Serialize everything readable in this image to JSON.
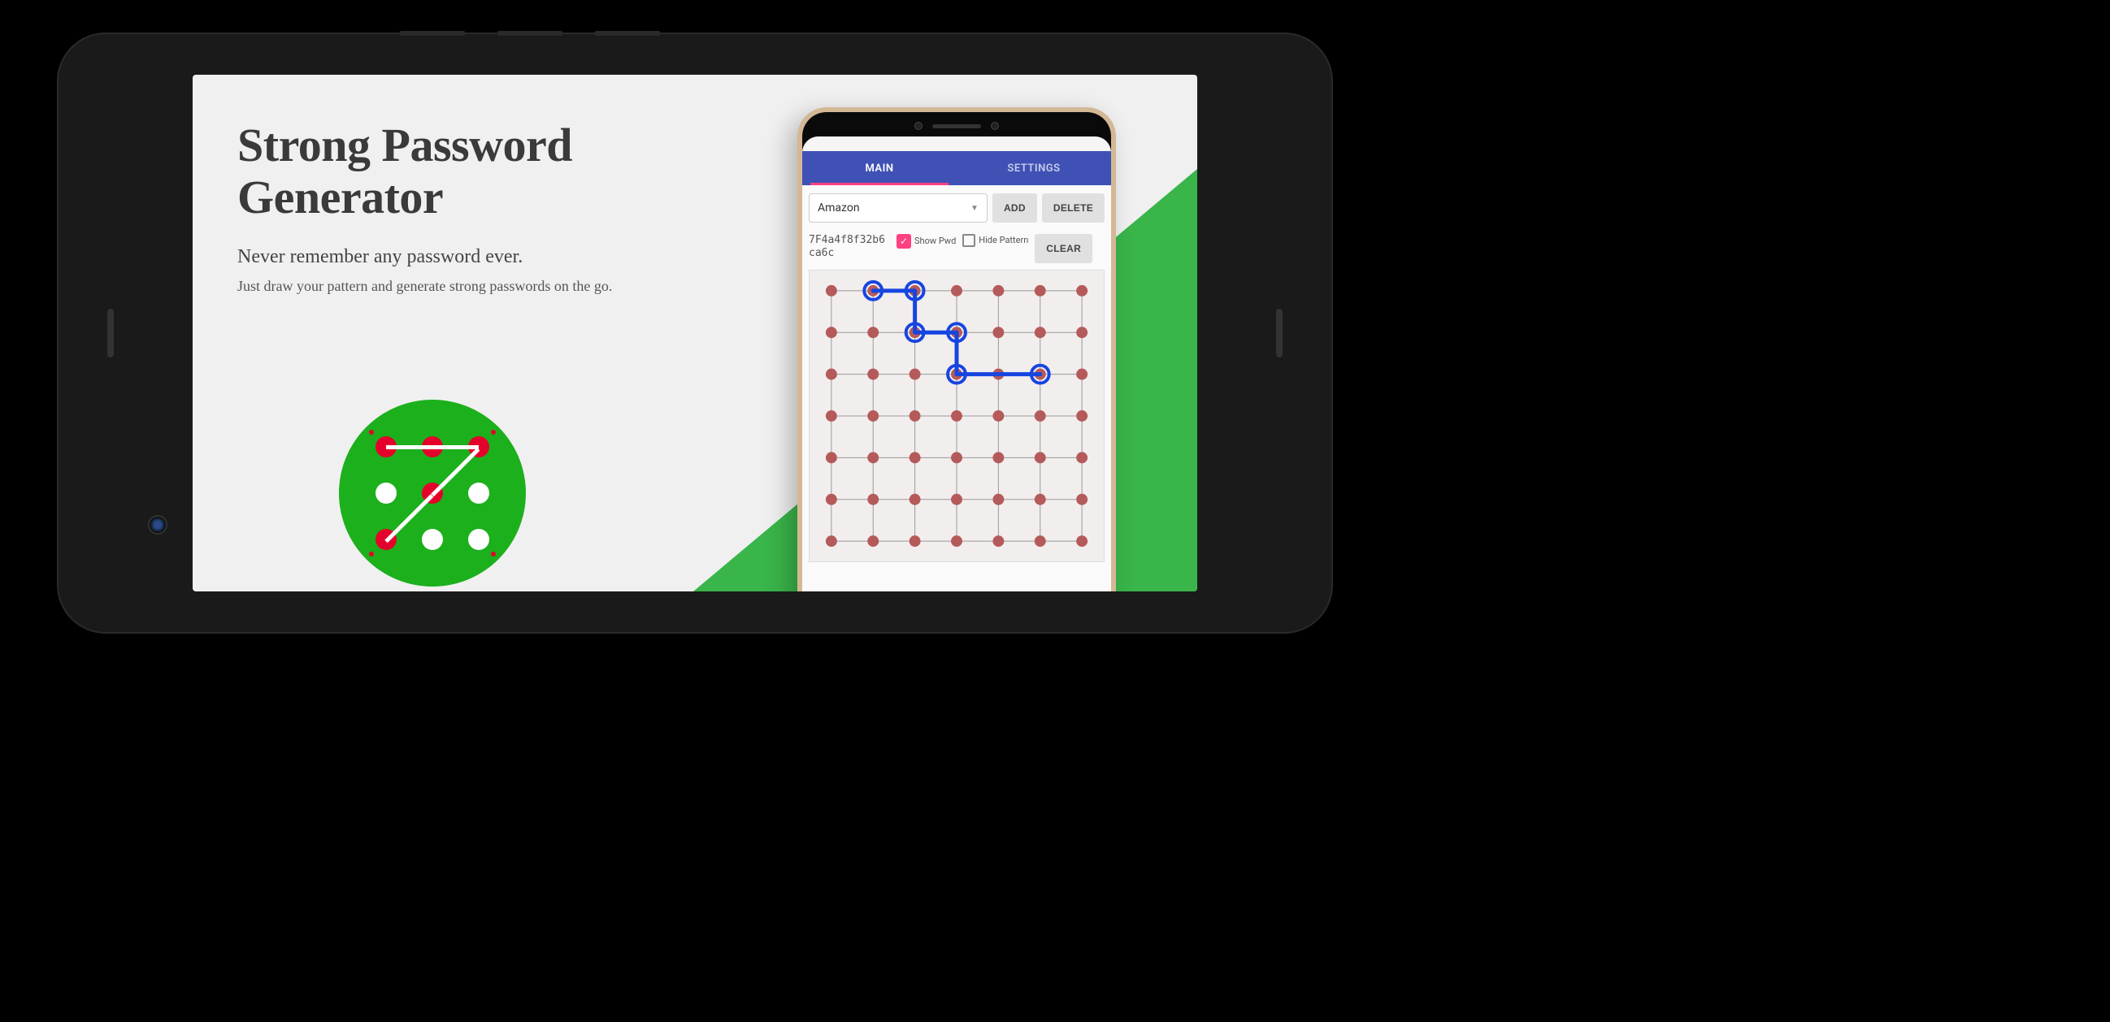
{
  "hero": {
    "title": "Strong Password Generator",
    "subtitle": "Never remember any password ever.",
    "body": "Just draw your pattern and generate strong passwords on the go."
  },
  "app": {
    "tabs": {
      "main": "MAIN",
      "settings": "SETTINGS"
    },
    "dropdown": {
      "selected": "Amazon"
    },
    "buttons": {
      "add": "ADD",
      "delete": "DELETE",
      "clear": "CLEAR"
    },
    "password": "7F4a4f8f32b6ca6c",
    "checks": {
      "show_pwd": "Show Pwd",
      "hide_pattern": "Hide Pattern"
    },
    "show_pwd_checked": true,
    "hide_pattern_checked": false,
    "grid_size": 7,
    "pattern_path": [
      [
        0,
        1
      ],
      [
        0,
        2
      ],
      [
        1,
        2
      ],
      [
        1,
        3
      ],
      [
        2,
        3
      ],
      [
        2,
        5
      ]
    ]
  },
  "colors": {
    "primary": "#3f51b5",
    "accent": "#ff4081",
    "green": "#39b54a",
    "dot": "#b55a5a",
    "path": "#1645e0"
  }
}
